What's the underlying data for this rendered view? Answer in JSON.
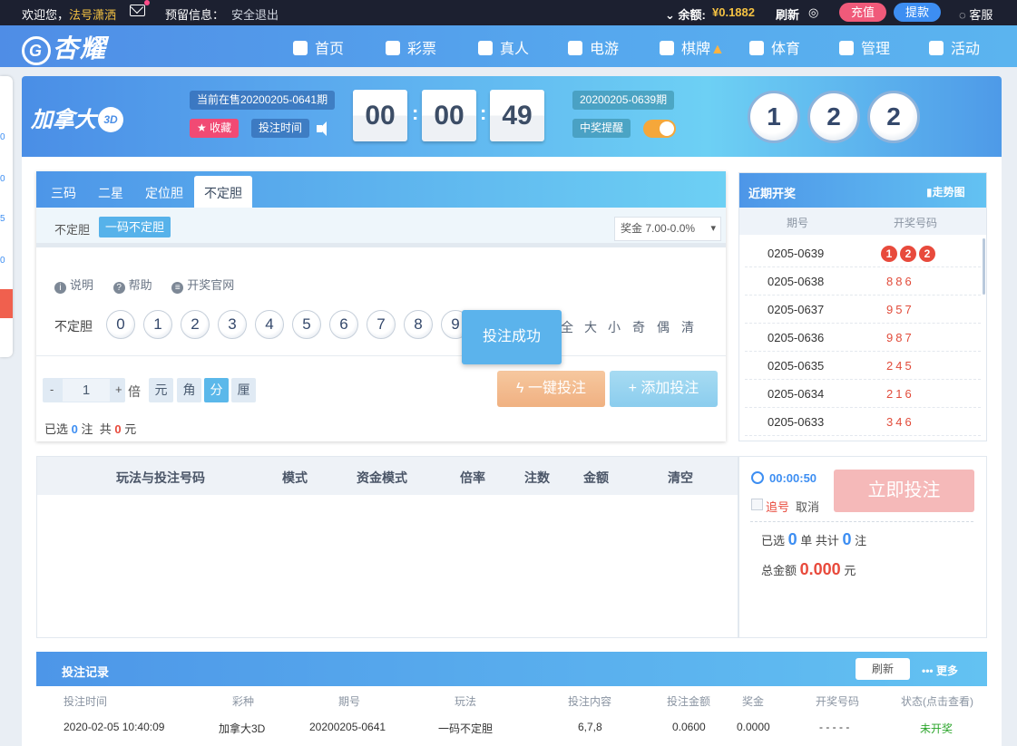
{
  "topbar": {
    "welcome": "欢迎您，",
    "username": "法号潇洒",
    "reserved": "预留信息：",
    "logout": "安全退出",
    "balance_label": "余额:",
    "balance": "¥0.1882",
    "refresh": "刷新",
    "deposit": "充值",
    "withdraw": "提款",
    "service": "客服"
  },
  "nav": {
    "logo": "杏耀",
    "items": [
      {
        "label": "首页",
        "icon": "home-icon"
      },
      {
        "label": "彩票",
        "icon": "ticket-icon"
      },
      {
        "label": "真人",
        "icon": "dealer-icon"
      },
      {
        "label": "电游",
        "icon": "slot-icon"
      },
      {
        "label": "棋牌",
        "icon": "cards-icon"
      },
      {
        "label": "体育",
        "icon": "trophy-icon"
      },
      {
        "label": "管理",
        "icon": "users-icon"
      },
      {
        "label": "活动",
        "icon": "gift-icon"
      }
    ]
  },
  "strip": {
    "numbers": [
      "0",
      "0",
      "5",
      "0"
    ]
  },
  "header": {
    "game_name": "加拿大",
    "badge": "3D",
    "on_sale": "当前在售20200205-0641期",
    "favorite": "收藏",
    "bet_time": "投注时间",
    "countdown": [
      "00",
      "00",
      "49"
    ],
    "last_issue": "20200205-0639期",
    "prize_alert": "中奖提醒",
    "result": [
      "1",
      "2",
      "2"
    ]
  },
  "play": {
    "tabs": [
      "三码",
      "二星",
      "定位胆",
      "不定胆"
    ],
    "active_tab": "不定胆",
    "sub_label": "不定胆",
    "sub_chip": "一码不定胆",
    "prize": "奖金 7.00-0.0%",
    "links": [
      "说明",
      "帮助",
      "开奖官网"
    ],
    "row_label": "不定胆",
    "numbers": [
      "0",
      "1",
      "2",
      "3",
      "4",
      "5",
      "6",
      "7",
      "8",
      "9"
    ],
    "filters": [
      "全",
      "大",
      "小",
      "奇",
      "偶",
      "清"
    ],
    "multiplier": "1",
    "times": "倍",
    "units": [
      "元",
      "角",
      "分",
      "厘"
    ],
    "active_unit": "分",
    "one_click": "一键投注",
    "add_bet": "添加投注",
    "selected_prefix": "已选",
    "selected_count": "0",
    "selected_unit": "注",
    "total_prefix": "共",
    "total_amount": "0",
    "total_unit": "元",
    "toast": "投注成功"
  },
  "recent": {
    "title": "近期开奖",
    "trend": "走势图",
    "col_issue": "期号",
    "col_code": "开奖号码",
    "rows": [
      {
        "issue": "0205-0639",
        "code": [
          "1",
          "2",
          "2"
        ]
      },
      {
        "issue": "0205-0638",
        "code": "886"
      },
      {
        "issue": "0205-0637",
        "code": "957"
      },
      {
        "issue": "0205-0636",
        "code": "987"
      },
      {
        "issue": "0205-0635",
        "code": "245"
      },
      {
        "issue": "0205-0634",
        "code": "216"
      },
      {
        "issue": "0205-0633",
        "code": "346"
      }
    ]
  },
  "betlist": {
    "columns": [
      "玩法与投注号码",
      "模式",
      "资金模式",
      "倍率",
      "注数",
      "金额",
      "清空"
    ]
  },
  "submit": {
    "timer": "00:00:50",
    "chase": "追号",
    "cancel": "取消",
    "bet_now": "立即投注",
    "selected": "已选",
    "orders": "0",
    "order_unit": "单 共计",
    "bets": "0",
    "bet_unit": "注",
    "total_label": "总金额",
    "total": "0.000",
    "total_unit": "元"
  },
  "records": {
    "title": "投注记录",
    "refresh": "刷新",
    "more": "更多",
    "columns": [
      "投注时间",
      "彩种",
      "期号",
      "玩法",
      "投注内容",
      "投注金额",
      "奖金",
      "开奖号码",
      "状态(点击查看)"
    ],
    "rows": [
      [
        "2020-02-05 10:40:09",
        "加拿大3D",
        "20200205-0641",
        "一码不定胆",
        "6,7,8",
        "0.0600",
        "0.0000",
        "- - - - -",
        "未开奖"
      ]
    ]
  }
}
